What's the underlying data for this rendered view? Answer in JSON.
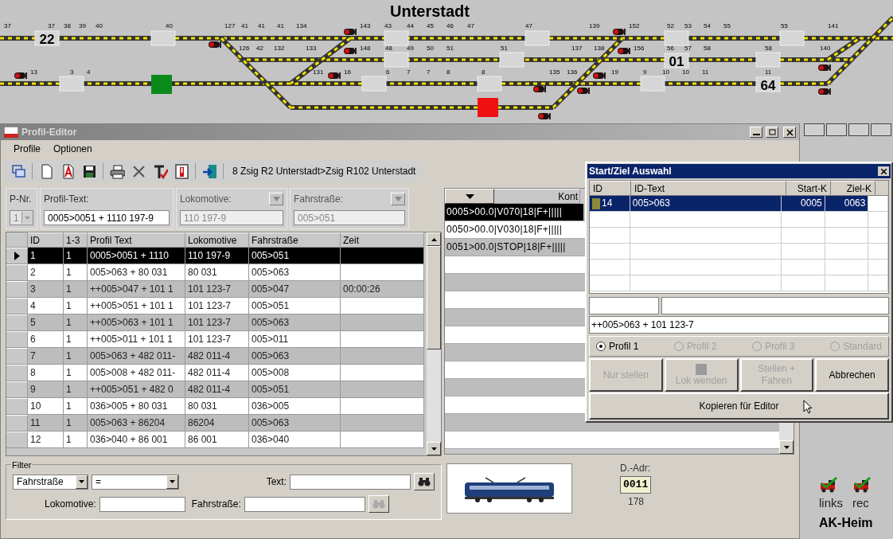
{
  "track_diagram": {
    "title": "Unterstadt",
    "block_numbers": [
      "22",
      "01",
      "64"
    ],
    "track_numbers": [
      [
        "37",
        "37",
        "38",
        "39",
        "40",
        "40",
        "127",
        "41",
        "41",
        "41",
        "134",
        "143",
        "43",
        "44",
        "45",
        "46",
        "47",
        "47",
        "139",
        "152",
        "52",
        "53",
        "54",
        "55",
        "55",
        "141"
      ],
      [
        "126",
        "42",
        "132",
        "133",
        "148",
        "48",
        "49",
        "50",
        "51",
        "51",
        "137",
        "138",
        "156",
        "56",
        "57",
        "58",
        "58",
        "140"
      ],
      [
        "13",
        "3",
        "4",
        "131",
        "16",
        "6",
        "7",
        "7",
        "8",
        "8",
        "135",
        "136",
        "19",
        "9",
        "10",
        "10",
        "11",
        "11"
      ]
    ]
  },
  "profile_editor": {
    "title": "Profil-Editor",
    "menu": [
      "Profile",
      "Optionen"
    ],
    "route": "8 Zsig R2 Unterstadt>Zsig R102 Unterstadt",
    "fields": [
      {
        "kind": "select",
        "label": "P-Nr.",
        "value": "1",
        "disabled": true
      },
      {
        "kind": "input",
        "label": "Profil-Text:",
        "value": "0005>0051 + 1110 197-9",
        "disabled": false
      },
      {
        "kind": "lookup",
        "label": "Lokomotive:",
        "value": "110 197-9",
        "disabled": true
      },
      {
        "kind": "lookup",
        "label": "Fahrstraße:",
        "value": "005>051",
        "disabled": true
      }
    ],
    "table": {
      "columns": [
        "ID",
        "1-3",
        "Profil Text",
        "Lokomotive",
        "Fahrstraße",
        "Zeit"
      ],
      "rows": [
        {
          "id": "1",
          "group": "1",
          "text": "0005>0051 + 1110",
          "loco": "110 197-9",
          "route": "005>051",
          "selected": true
        },
        {
          "id": "2",
          "group": "1",
          "text": "005>063 + 80 031",
          "loco": "80 031",
          "route": "005>063",
          "selected": false
        },
        {
          "id": "3",
          "group": "1",
          "text": "++005>047 + 101 1",
          "loco": "101 123-7",
          "route": "005>047",
          "time": "00:00:26",
          "selected": false
        },
        {
          "id": "4",
          "group": "1",
          "text": "++005>051 + 101 1",
          "loco": "101 123-7",
          "route": "005>051",
          "selected": false
        },
        {
          "id": "5",
          "group": "1",
          "text": "++005>063 + 101 1",
          "loco": "101 123-7",
          "route": "005>063",
          "selected": false
        },
        {
          "id": "6",
          "group": "1",
          "text": "++005>011 + 101 1",
          "loco": "101 123-7",
          "route": "005>011",
          "selected": false
        },
        {
          "id": "7",
          "group": "1",
          "text": "005>063 + 482 011-",
          "loco": "482 011-4",
          "route": "005>063",
          "selected": false
        },
        {
          "id": "8",
          "group": "1",
          "text": "005>008 + 482 011-",
          "loco": "482 011-4",
          "route": "005>008",
          "selected": false
        },
        {
          "id": "9",
          "group": "1",
          "text": "++005>051 + 482 0",
          "loco": "482 011-4",
          "route": "005>051",
          "selected": false
        },
        {
          "id": "10",
          "group": "1",
          "text": "036>005 + 80 031",
          "loco": "80 031",
          "route": "036>005",
          "selected": false
        },
        {
          "id": "11",
          "group": "1",
          "text": "005>063 + 86204",
          "loco": "86204",
          "route": "005>063",
          "selected": false
        },
        {
          "id": "12",
          "group": "1",
          "text": "036>040 + 86 001",
          "loco": "86 001",
          "route": "036>040",
          "selected": false
        }
      ]
    },
    "command_list": {
      "header": "Kont",
      "rows": [
        {
          "text": "0005>00.0|V070|18|F+|||||",
          "selected": true
        },
        {
          "text": "0050>00.0|V030|18|F+|||||",
          "selected": false
        },
        {
          "text": "0051>00.0|STOP|18|F+|||||",
          "selected": false
        }
      ]
    },
    "filter": {
      "title": "Filter",
      "field": "Fahrstraße",
      "operator": "=",
      "text_label": "Text:",
      "loco_label": "Lokomotive:",
      "route_label": "Fahrstraße:"
    },
    "decoder": {
      "label": "D.-Adr:",
      "address": "0011",
      "number": "178"
    }
  },
  "selection_dialog": {
    "title": "Start/Ziel Auswahl",
    "columns": [
      "ID",
      "ID-Text",
      "Start-K",
      "Ziel-K"
    ],
    "rows": [
      {
        "id": "14",
        "text": "005>063",
        "start": "0005",
        "target": "0063",
        "selected": true
      }
    ],
    "profile_text": "++005>063 + 101 123-7",
    "options": [
      {
        "label": "Profil 1",
        "selected": true,
        "disabled": false
      },
      {
        "label": "Profil 2",
        "selected": false,
        "disabled": true
      },
      {
        "label": "Profil 3",
        "selected": false,
        "disabled": true
      },
      {
        "label": "Standard",
        "selected": false,
        "disabled": true
      }
    ],
    "buttons": [
      {
        "label": "Nur stellen",
        "kind": "text",
        "disabled": true
      },
      {
        "label": "Lok wenden",
        "kind": "icon",
        "disabled": true
      },
      {
        "label": "Stellen + Fahren",
        "kind": "text",
        "disabled": true
      },
      {
        "label": "Abbrechen",
        "kind": "text",
        "disabled": false
      }
    ],
    "copy_button": "Kopieren für Editor"
  },
  "side_panel": {
    "labels": [
      "links",
      "rec"
    ],
    "name": "AK-Heim"
  }
}
